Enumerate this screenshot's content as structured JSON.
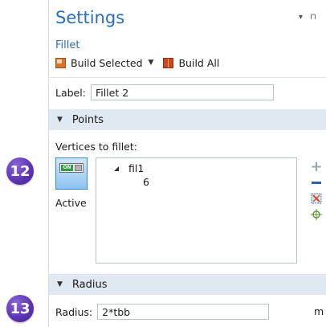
{
  "badges": {
    "step12": "12",
    "step13": "13"
  },
  "panel": {
    "title": "Settings",
    "subtitle": "Fillet",
    "window_controls": "▾ ⊓"
  },
  "toolbar": {
    "build_selected_label": "Build Selected",
    "build_all_label": "Build All"
  },
  "label_field": {
    "label": "Label:",
    "value": "Fillet 2"
  },
  "points_section": {
    "title": "Points",
    "vertices_label": "Vertices to fillet:",
    "toggle_text": "ON",
    "active_label": "Active",
    "tree": {
      "node": "fil1",
      "child": "6"
    }
  },
  "radius_section": {
    "title": "Radius",
    "label": "Radius:",
    "value": "2*tbb",
    "unit": "m"
  },
  "icons": {
    "add": "plus-icon",
    "remove": "minus-icon",
    "clear": "clear-selection-icon",
    "zoom": "zoom-to-selection-icon"
  },
  "colors": {
    "accent": "#2a6ebb",
    "section_bg": "#e0e8f1",
    "badge": "#5a32b0"
  }
}
